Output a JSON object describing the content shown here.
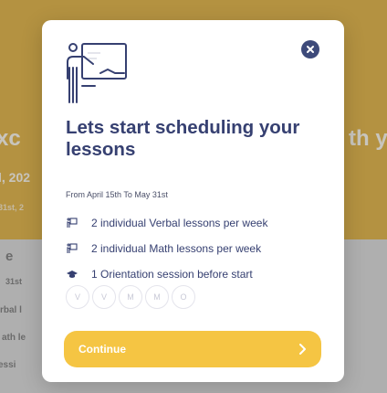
{
  "background": {
    "heading_left": "xc",
    "heading_right": "th y",
    "date_left": "l, 202",
    "small_left": "31st, 2",
    "section_e": "e",
    "section_31st": "31st",
    "line_rbal": "rbal l",
    "line_ath": "ath le",
    "line_sessi": "essi"
  },
  "modal": {
    "title": "Lets start scheduling your lessons",
    "date_range": "From April 15th To May 31st",
    "items": [
      {
        "icon": "chalkboard-icon",
        "label": "2 individual Verbal lessons per week"
      },
      {
        "icon": "chalkboard-icon",
        "label": "2 individual Math lessons per week"
      },
      {
        "icon": "graduation-cap-icon",
        "label": "1 Orientation session before start"
      }
    ],
    "tokens": [
      "V",
      "V",
      "M",
      "M",
      "O"
    ],
    "continue_label": "Continue"
  },
  "colors": {
    "accent": "#f5c543",
    "primary_text": "#364071",
    "close_button": "#3d4a7a",
    "background_top": "#e0b041"
  }
}
